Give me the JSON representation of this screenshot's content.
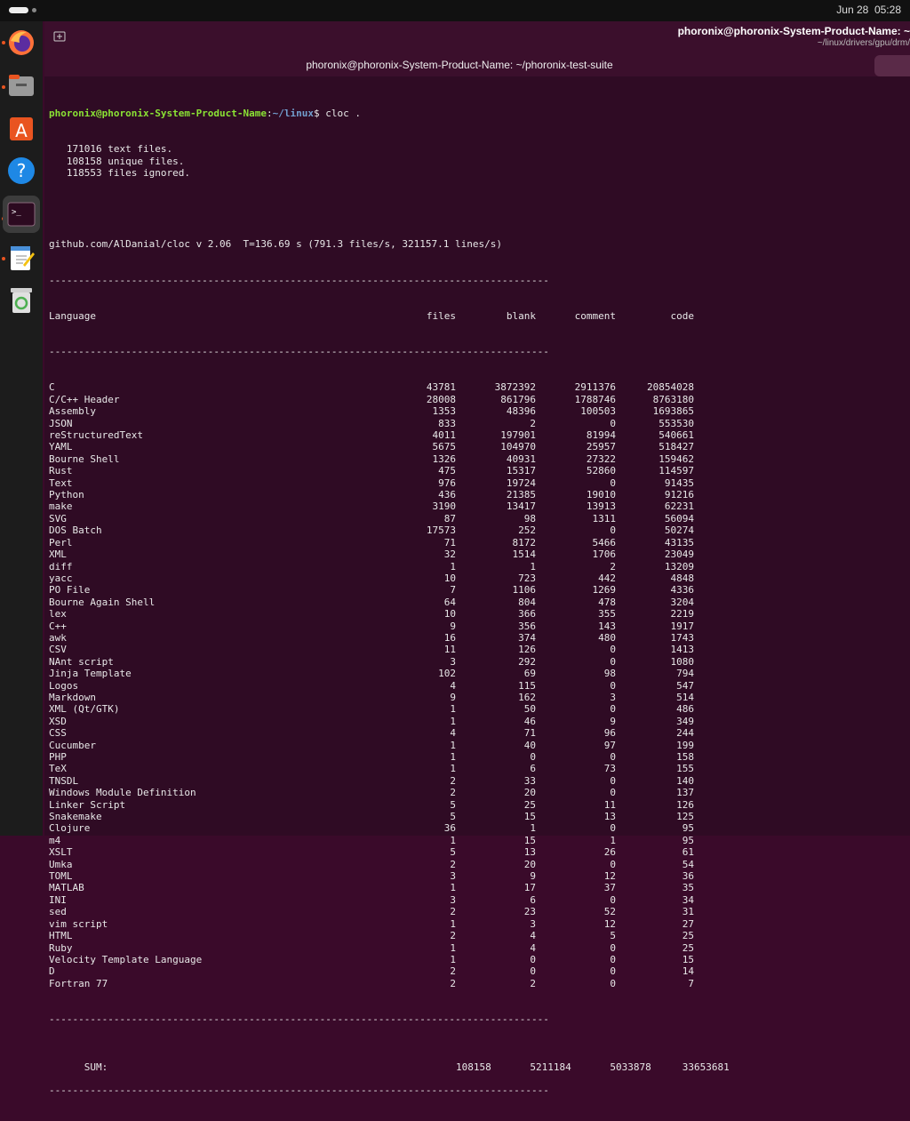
{
  "topbar": {
    "clock": "Jun 28  05:28"
  },
  "dock": {
    "items": [
      "firefox-icon",
      "files-icon",
      "app-center-icon",
      "help-icon",
      "terminal-icon",
      "text-editor-icon",
      "trash-icon"
    ],
    "colors": {
      "accent": "#e95420",
      "active_bg": "#3c3c3c"
    }
  },
  "window": {
    "tab_title": "phoronix@phoronix-System-Product-Name: ~",
    "tab_subtitle": "~/linux/drivers/gpu/drm/",
    "title": "phoronix@phoronix-System-Product-Name: ~/phoronix-test-suite"
  },
  "terminal": {
    "prompt_user": "phoronix@phoronix-System-Product-Name",
    "prompt_sep": ":",
    "prompt_path": "~/linux",
    "prompt_cmd": "$ cloc .",
    "info": [
      "   171016 text files.",
      "   108158 unique files.",
      "   118553 files ignored."
    ],
    "summary": "github.com/AlDanial/cloc v 2.06  T=136.69 s (791.3 files/s, 321157.1 lines/s)",
    "separator": "-------------------------------------------------------------------------------------",
    "header": {
      "language": "Language",
      "files": "files",
      "blank": "blank",
      "comment": "comment",
      "code": "code"
    },
    "rows": [
      [
        "C",
        "43781",
        "3872392",
        "2911376",
        "20854028"
      ],
      [
        "C/C++ Header",
        "28008",
        "861796",
        "1788746",
        "8763180"
      ],
      [
        "Assembly",
        "1353",
        "48396",
        "100503",
        "1693865"
      ],
      [
        "JSON",
        "833",
        "2",
        "0",
        "553530"
      ],
      [
        "reStructuredText",
        "4011",
        "197901",
        "81994",
        "540661"
      ],
      [
        "YAML",
        "5675",
        "104970",
        "25957",
        "518427"
      ],
      [
        "Bourne Shell",
        "1326",
        "40931",
        "27322",
        "159462"
      ],
      [
        "Rust",
        "475",
        "15317",
        "52860",
        "114597"
      ],
      [
        "Text",
        "976",
        "19724",
        "0",
        "91435"
      ],
      [
        "Python",
        "436",
        "21385",
        "19010",
        "91216"
      ],
      [
        "make",
        "3190",
        "13417",
        "13913",
        "62231"
      ],
      [
        "SVG",
        "87",
        "98",
        "1311",
        "56094"
      ],
      [
        "DOS Batch",
        "17573",
        "252",
        "0",
        "50274"
      ],
      [
        "Perl",
        "71",
        "8172",
        "5466",
        "43135"
      ],
      [
        "XML",
        "32",
        "1514",
        "1706",
        "23049"
      ],
      [
        "diff",
        "1",
        "1",
        "2",
        "13209"
      ],
      [
        "yacc",
        "10",
        "723",
        "442",
        "4848"
      ],
      [
        "PO File",
        "7",
        "1106",
        "1269",
        "4336"
      ],
      [
        "Bourne Again Shell",
        "64",
        "804",
        "478",
        "3204"
      ],
      [
        "lex",
        "10",
        "366",
        "355",
        "2219"
      ],
      [
        "C++",
        "9",
        "356",
        "143",
        "1917"
      ],
      [
        "awk",
        "16",
        "374",
        "480",
        "1743"
      ],
      [
        "CSV",
        "11",
        "126",
        "0",
        "1413"
      ],
      [
        "NAnt script",
        "3",
        "292",
        "0",
        "1080"
      ],
      [
        "Jinja Template",
        "102",
        "69",
        "98",
        "794"
      ],
      [
        "Logos",
        "4",
        "115",
        "0",
        "547"
      ],
      [
        "Markdown",
        "9",
        "162",
        "3",
        "514"
      ],
      [
        "XML (Qt/GTK)",
        "1",
        "50",
        "0",
        "486"
      ],
      [
        "XSD",
        "1",
        "46",
        "9",
        "349"
      ],
      [
        "CSS",
        "4",
        "71",
        "96",
        "244"
      ],
      [
        "Cucumber",
        "1",
        "40",
        "97",
        "199"
      ],
      [
        "PHP",
        "1",
        "0",
        "0",
        "158"
      ],
      [
        "TeX",
        "1",
        "6",
        "73",
        "155"
      ],
      [
        "TNSDL",
        "2",
        "33",
        "0",
        "140"
      ],
      [
        "Windows Module Definition",
        "2",
        "20",
        "0",
        "137"
      ],
      [
        "Linker Script",
        "5",
        "25",
        "11",
        "126"
      ],
      [
        "Snakemake",
        "5",
        "15",
        "13",
        "125"
      ],
      [
        "Clojure",
        "36",
        "1",
        "0",
        "95"
      ],
      [
        "m4",
        "1",
        "15",
        "1",
        "95"
      ],
      [
        "XSLT",
        "5",
        "13",
        "26",
        "61"
      ],
      [
        "Umka",
        "2",
        "20",
        "0",
        "54"
      ],
      [
        "TOML",
        "3",
        "9",
        "12",
        "36"
      ],
      [
        "MATLAB",
        "1",
        "17",
        "37",
        "35"
      ],
      [
        "INI",
        "3",
        "6",
        "0",
        "34"
      ],
      [
        "sed",
        "2",
        "23",
        "52",
        "31"
      ],
      [
        "vim script",
        "1",
        "3",
        "12",
        "27"
      ],
      [
        "HTML",
        "2",
        "4",
        "5",
        "25"
      ],
      [
        "Ruby",
        "1",
        "4",
        "0",
        "25"
      ],
      [
        "Velocity Template Language",
        "1",
        "0",
        "0",
        "15"
      ],
      [
        "D",
        "2",
        "0",
        "0",
        "14"
      ],
      [
        "Fortran 77",
        "2",
        "2",
        "0",
        "7"
      ]
    ],
    "sum": [
      "SUM:",
      "108158",
      "5211184",
      "5033878",
      "33653681"
    ]
  }
}
